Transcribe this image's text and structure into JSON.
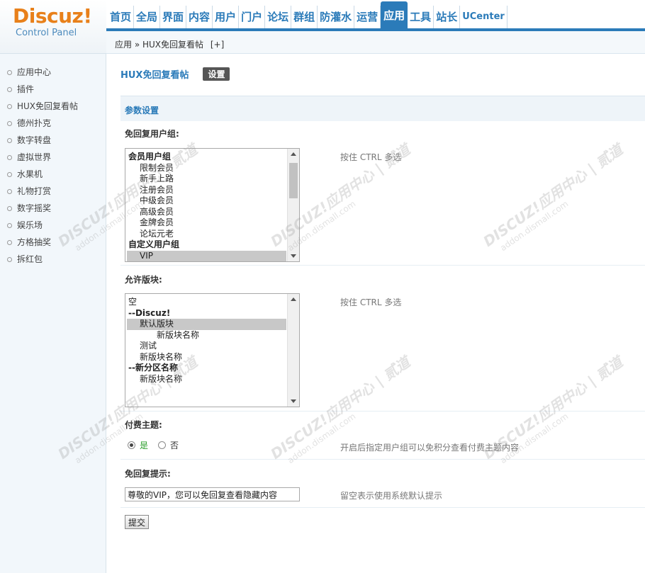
{
  "logo": {
    "main": "Discuz!",
    "sub": "Control Panel"
  },
  "nav": [
    {
      "label": "首页"
    },
    {
      "label": "全局"
    },
    {
      "label": "界面"
    },
    {
      "label": "内容"
    },
    {
      "label": "用户"
    },
    {
      "label": "门户"
    },
    {
      "label": "论坛"
    },
    {
      "label": "群组"
    },
    {
      "label": "防灌水"
    },
    {
      "label": "运营"
    },
    {
      "label": "应用",
      "active": true
    },
    {
      "label": "工具"
    },
    {
      "label": "站长"
    },
    {
      "label": "UCenter"
    }
  ],
  "breadcrumb": {
    "text": "应用 » HUX免回复看帖",
    "add": "[+]"
  },
  "sidebar": {
    "items": [
      {
        "label": "应用中心"
      },
      {
        "label": "插件"
      },
      {
        "label": "HUX免回复看帖"
      },
      {
        "label": "德州扑克"
      },
      {
        "label": "数字转盘"
      },
      {
        "label": "虚拟世界"
      },
      {
        "label": "水果机"
      },
      {
        "label": "礼物打赏"
      },
      {
        "label": "数字摇奖"
      },
      {
        "label": "娱乐场"
      },
      {
        "label": "方格抽奖"
      },
      {
        "label": "拆红包"
      }
    ]
  },
  "main": {
    "title": "HUX免回复看帖",
    "tab_settings": "设置",
    "section_title": "参数设置",
    "usergroups": {
      "label": "免回复用户组:",
      "hint": "按住 CTRL 多选",
      "options": [
        {
          "text": "会员用户组",
          "kind": "group"
        },
        {
          "text": "限制会员",
          "kind": "indent1"
        },
        {
          "text": "新手上路",
          "kind": "indent1"
        },
        {
          "text": "注册会员",
          "kind": "indent1"
        },
        {
          "text": "中级会员",
          "kind": "indent1"
        },
        {
          "text": "高级会员",
          "kind": "indent1"
        },
        {
          "text": "金牌会员",
          "kind": "indent1"
        },
        {
          "text": "论坛元老",
          "kind": "indent1"
        },
        {
          "text": "自定义用户组",
          "kind": "group"
        },
        {
          "text": "VIP",
          "kind": "indent1",
          "selected": true
        }
      ]
    },
    "forums": {
      "label": "允许版块:",
      "hint": "按住 CTRL 多选",
      "options": [
        {
          "text": "空",
          "kind": "plain"
        },
        {
          "text": "--Discuz!",
          "kind": "group"
        },
        {
          "text": "默认版块",
          "kind": "indent1",
          "selected": true
        },
        {
          "text": "新版块名称",
          "kind": "indent2"
        },
        {
          "text": "测试",
          "kind": "indent1"
        },
        {
          "text": "新版块名称",
          "kind": "indent1"
        },
        {
          "text": "--新分区名称",
          "kind": "group"
        },
        {
          "text": "新版块名称",
          "kind": "indent1"
        }
      ]
    },
    "paid_thread": {
      "label": "付费主题:",
      "yes": "是",
      "no": "否",
      "hint": "开启后指定用户组可以免积分查看付费主题内容"
    },
    "reply_notice": {
      "label": "免回复提示:",
      "value": "尊敬的VIP，您可以免回复查看隐藏内容",
      "hint": "留空表示使用系统默认提示"
    },
    "submit_label": "提交"
  },
  "watermark": {
    "line1": "DISCUZ!应用中心 | 贰道",
    "line2": "addon.dismall.com"
  }
}
